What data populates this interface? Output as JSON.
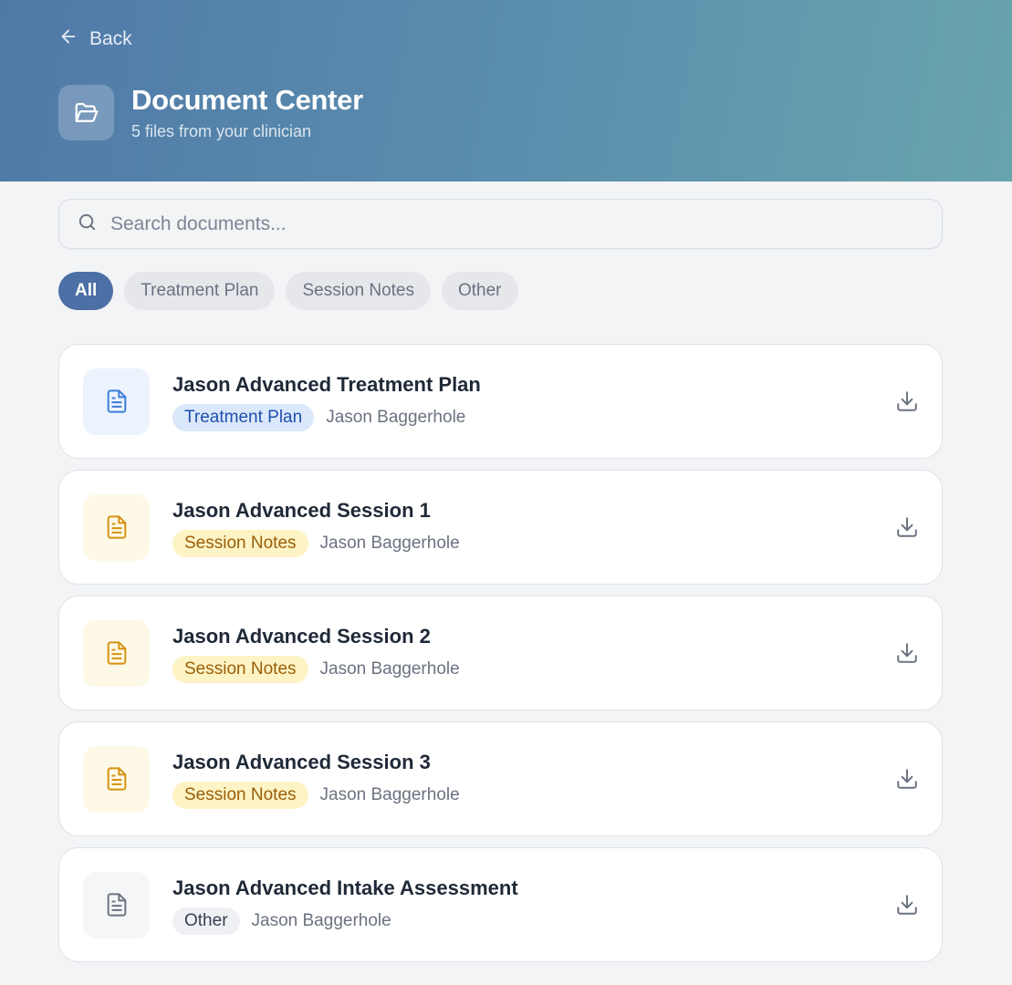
{
  "header": {
    "back_label": "Back",
    "title": "Document Center",
    "subtitle": "5 files from your clinician",
    "gradient_start": "#5079a8",
    "gradient_end": "#68a4ad"
  },
  "search": {
    "placeholder": "Search documents...",
    "value": ""
  },
  "filters": [
    {
      "label": "All",
      "active": true
    },
    {
      "label": "Treatment Plan",
      "active": false
    },
    {
      "label": "Session Notes",
      "active": false
    },
    {
      "label": "Other",
      "active": false
    }
  ],
  "documents": [
    {
      "name": "Jason Advanced Treatment Plan",
      "category": "Treatment Plan",
      "author": "Jason Baggerhole",
      "icon": "document-icon",
      "icon_color": "#3b7dd8",
      "icon_bg": "#ecf3fd",
      "tag_bg": "#dbe8fb",
      "tag_color": "#1e4fae"
    },
    {
      "name": "Jason Advanced Session 1",
      "category": "Session Notes",
      "author": "Jason Baggerhole",
      "icon": "document-icon",
      "icon_color": "#d4920f",
      "icon_bg": "#fef9e7",
      "tag_bg": "#fdf3c4",
      "tag_color": "#9a5f0a"
    },
    {
      "name": "Jason Advanced Session 2",
      "category": "Session Notes",
      "author": "Jason Baggerhole",
      "icon": "document-icon",
      "icon_color": "#d4920f",
      "icon_bg": "#fef9e7",
      "tag_bg": "#fdf3c4",
      "tag_color": "#9a5f0a"
    },
    {
      "name": "Jason Advanced Session 3",
      "category": "Session Notes",
      "author": "Jason Baggerhole",
      "icon": "document-icon",
      "icon_color": "#d4920f",
      "icon_bg": "#fef9e7",
      "tag_bg": "#fdf3c4",
      "tag_color": "#9a5f0a"
    },
    {
      "name": "Jason Advanced Intake Assessment",
      "category": "Other",
      "author": "Jason Baggerhole",
      "icon": "document-icon",
      "icon_color": "#6b7280",
      "icon_bg": "#f5f6f8",
      "tag_bg": "#eef0f3",
      "tag_color": "#374151"
    }
  ]
}
